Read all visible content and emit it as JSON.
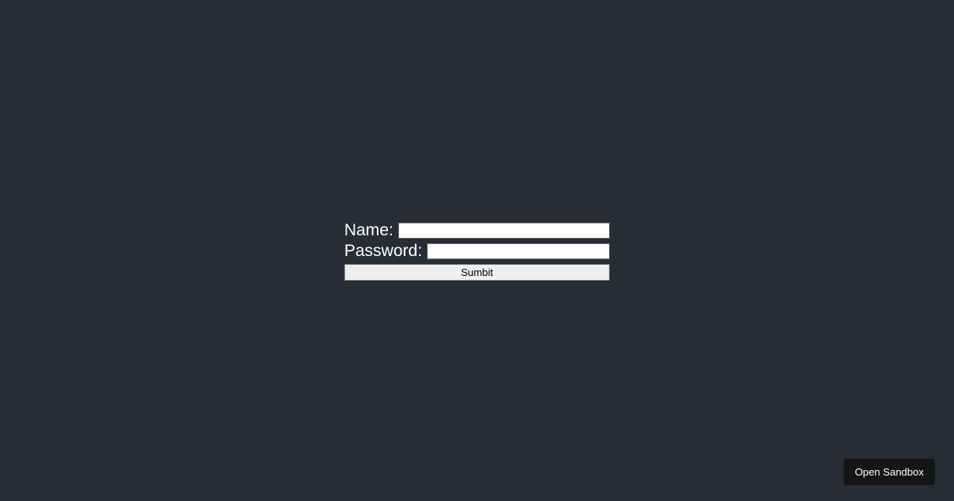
{
  "form": {
    "name_label": "Name:",
    "name_value": "",
    "password_label": "Password:",
    "password_value": "",
    "submit_label": "Sumbit"
  },
  "sandbox": {
    "button_label": "Open Sandbox"
  },
  "colors": {
    "background": "#282c34",
    "text": "#ffffff",
    "button_bg": "#efefef",
    "sandbox_bg": "#151515"
  }
}
